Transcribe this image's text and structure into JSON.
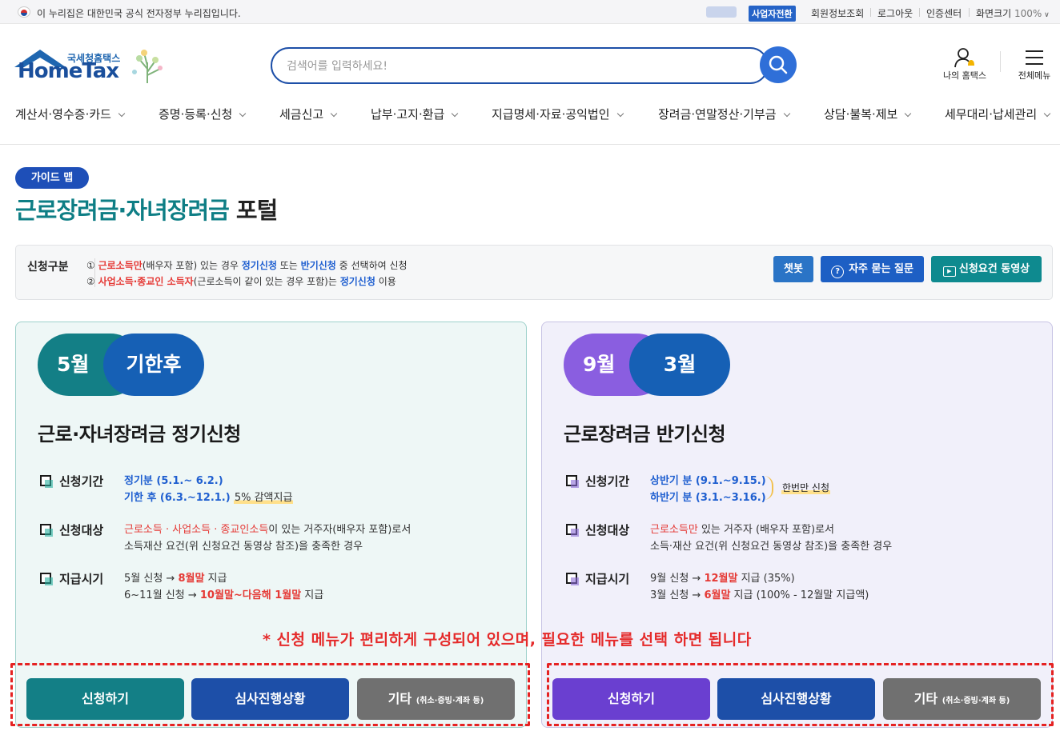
{
  "topbar": {
    "notice": "이 누리집은 대한민국 공식 전자정부 누리집입니다.",
    "biz_switch": "사업자전환",
    "links": [
      "회원정보조회",
      "로그아웃",
      "인증센터"
    ],
    "zoom_label": "화면크기",
    "zoom_value": "100%"
  },
  "logo": {
    "sub": "국세청홈택스",
    "main": "HomeTax"
  },
  "search": {
    "placeholder": "검색어를 입력하세요!"
  },
  "header": {
    "my_home": "나의 홈택스",
    "all_menu": "전체메뉴"
  },
  "gnb": [
    "계산서·영수증·카드",
    "증명·등록·신청",
    "세금신고",
    "납부·고지·환급",
    "지급명세·자료·공익법인",
    "장려금·연말정산·기부금",
    "상담·불복·제보",
    "세무대리·납세관리"
  ],
  "page": {
    "badge": "가이드 맵",
    "title_green": "근로장려금·자녀장려금",
    "title_black": " 포털"
  },
  "info": {
    "label": "신청구분",
    "l1": {
      "a": "① ",
      "b": "근로소득만",
      "c": "(배우자 포함) 있는 경우 ",
      "d": "정기신청",
      "e": " 또는 ",
      "f": "반기신청",
      "g": " 중 선택하여 신청"
    },
    "l2": {
      "a": "② ",
      "b": "사업소득·종교인 소득자",
      "c": "(근로소득이 같이 있는 경우 포함)는 ",
      "d": "정기신청",
      "e": " 이용"
    },
    "buttons": {
      "chatbot": "챗봇",
      "faq": "자주 묻는 질문",
      "video": "신청요건 동영상"
    }
  },
  "left": {
    "pill_a": "5월",
    "pill_b": "기한후",
    "title": "근로·자녀장려금 정기신청",
    "period_label": "신청기간",
    "period_1": "정기분 (5.1.~ 6.2.)",
    "period_2": "기한 후 (6.3.~12.1.)",
    "period_2b": "5% 감액지급",
    "target_label": "신청대상",
    "target_1a": "근로소득 · 사업소득 · 종교인소득",
    "target_1b": "이 있는 거주자(배우자 포함)로서",
    "target_2": "소득재산 요건(위 신청요건 동영상 참조)을 충족한 경우",
    "pay_label": "지급시기",
    "pay_1a": "5월 신청 → ",
    "pay_1b": "8월말",
    "pay_1c": " 지급",
    "pay_2a": "6~11월 신청 → ",
    "pay_2b": "10월말~다음해 1월말",
    "pay_2c": " 지급",
    "btn_apply": "신청하기",
    "btn_status": "심사진행상황",
    "btn_etc": "기타",
    "btn_etc_small": "(취소·증빙·계좌 등)"
  },
  "right": {
    "pill_a": "9월",
    "pill_b": "3월",
    "title": "근로장려금 반기신청",
    "period_label": "신청기간",
    "period_1": "상반기 분 (9.1.~9.15.)",
    "period_2": "하반기 분 (3.1.~3.16.)",
    "period_note": "한번만 신청",
    "target_label": "신청대상",
    "target_1a": "근로소득만",
    "target_1b": " 있는 거주자 (배우자 포함)로서",
    "target_2": "소득·재산 요건(위 신청요건 동영상 참조)을 충족한 경우",
    "pay_label": "지급시기",
    "pay_1a": "9월 신청 → ",
    "pay_1b": "12월말",
    "pay_1c": " 지급 (35%)",
    "pay_2a": "3월 신청 → ",
    "pay_2b": "6월말",
    "pay_2c": " 지급 (100% - 12월말 지급액)",
    "btn_apply": "신청하기",
    "btn_status": "심사진행상황",
    "btn_etc": "기타",
    "btn_etc_small": "(취소·증빙·계좌 등)"
  },
  "note": "* 신청 메뉴가 편리하게 구성되어 있으며, 필요한 메뉴를 선택 하면 됩니다",
  "colors": {
    "teal": "#0e7e85",
    "navy": "#1d4fa8",
    "purple": "#6a3fd0",
    "gray": "#707070",
    "red": "#e53935",
    "blue": "#1f5fd0"
  }
}
